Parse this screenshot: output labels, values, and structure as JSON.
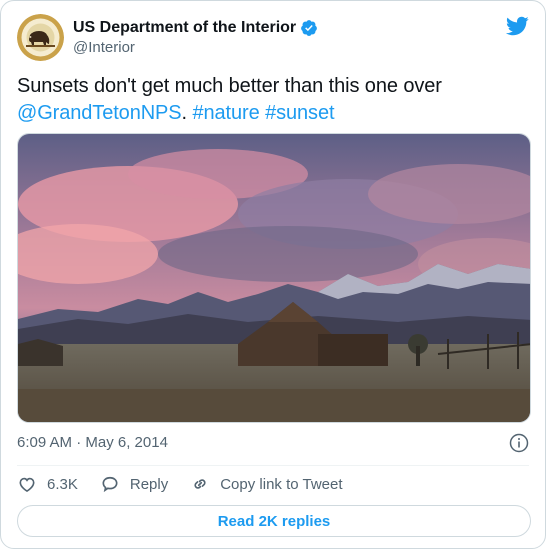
{
  "author": {
    "display_name": "US Department of the Interior",
    "handle": "@Interior",
    "verified": true,
    "avatar_icon": "doi-bison-seal-icon"
  },
  "brand": {
    "logo_icon": "twitter-bird-icon",
    "accent": "#1d9bf0"
  },
  "tweet": {
    "text_plain": "Sunsets don't get much better than this one over ",
    "mention": "@GrandTetonNPS",
    "separator": ". ",
    "hashtag_1": "#nature",
    "hashtag_2": "#sunset"
  },
  "media": {
    "description_icon": "photo-barn-mountains-sunset"
  },
  "meta": {
    "timestamp": "6:09 AM · May 6, 2014"
  },
  "actions": {
    "like_count": "6.3K",
    "reply_label": "Reply",
    "copy_label": "Copy link to Tweet"
  },
  "footer": {
    "read_replies_label": "Read 2K replies"
  }
}
